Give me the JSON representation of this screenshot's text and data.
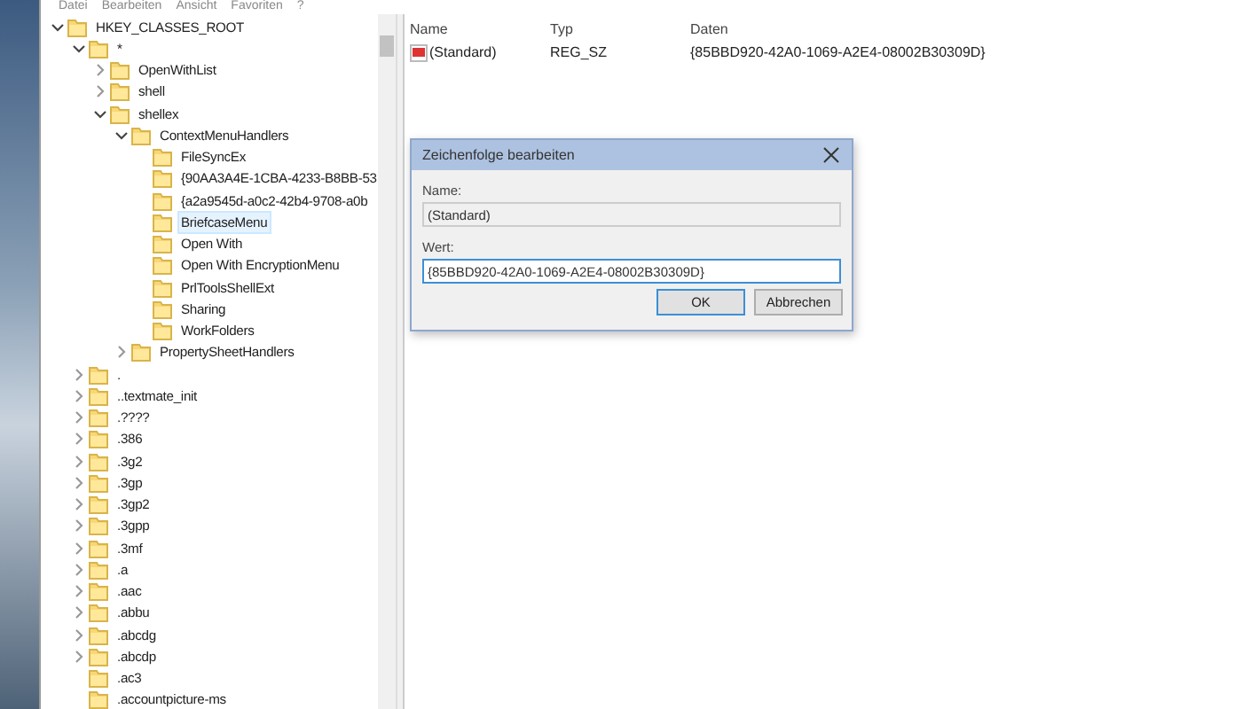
{
  "menu": [
    "Datei",
    "Bearbeiten",
    "Ansicht",
    "Favoriten",
    "?"
  ],
  "tree": [
    {
      "label": "HKEY_CLASSES_ROOT",
      "expanded": true,
      "selected": false,
      "children": [
        {
          "label": "*",
          "expanded": true,
          "selected": false,
          "children": [
            {
              "label": "OpenWithList",
              "expanded": false,
              "selected": false
            },
            {
              "label": "shell",
              "expanded": false,
              "selected": false
            },
            {
              "label": "shellex",
              "expanded": true,
              "selected": false,
              "children": [
                {
                  "label": "ContextMenuHandlers",
                  "expanded": true,
                  "selected": false,
                  "children": [
                    {
                      "label": "FileSyncEx",
                      "selected": false
                    },
                    {
                      "label": "{90AA3A4E-1CBA-4233-B8BB-53",
                      "selected": false
                    },
                    {
                      "label": "{a2a9545d-a0c2-42b4-9708-a0b",
                      "selected": false
                    },
                    {
                      "label": "BriefcaseMenu",
                      "selected": true
                    },
                    {
                      "label": "Open With",
                      "selected": false
                    },
                    {
                      "label": "Open With EncryptionMenu",
                      "selected": false
                    },
                    {
                      "label": "PrlToolsShellExt",
                      "selected": false
                    },
                    {
                      "label": "Sharing",
                      "selected": false
                    },
                    {
                      "label": "WorkFolders",
                      "selected": false
                    }
                  ]
                },
                {
                  "label": "PropertySheetHandlers",
                  "expanded": false,
                  "selected": false
                }
              ]
            }
          ]
        },
        {
          "label": ".",
          "expanded": false,
          "selected": false
        },
        {
          "label": "..textmate_init",
          "expanded": false,
          "selected": false
        },
        {
          "label": ".????",
          "expanded": false,
          "selected": false
        },
        {
          "label": ".386",
          "expanded": false,
          "selected": false
        },
        {
          "label": ".3g2",
          "expanded": false,
          "selected": false
        },
        {
          "label": ".3gp",
          "expanded": false,
          "selected": false
        },
        {
          "label": ".3gp2",
          "expanded": false,
          "selected": false
        },
        {
          "label": ".3gpp",
          "expanded": false,
          "selected": false
        },
        {
          "label": ".3mf",
          "expanded": false,
          "selected": false
        },
        {
          "label": ".a",
          "expanded": false,
          "selected": false
        },
        {
          "label": ".aac",
          "expanded": false,
          "selected": false
        },
        {
          "label": ".abbu",
          "expanded": false,
          "selected": false
        },
        {
          "label": ".abcdg",
          "expanded": false,
          "selected": false
        },
        {
          "label": ".abcdp",
          "expanded": false,
          "selected": false
        },
        {
          "label": ".ac3",
          "selected": false
        },
        {
          "label": ".accountpicture-ms",
          "selected": false
        }
      ]
    }
  ],
  "values": {
    "columns": [
      "Name",
      "Typ",
      "Daten"
    ],
    "rows": [
      {
        "name": "(Standard)",
        "type": "REG_SZ",
        "data": "{85BBD920-42A0-1069-A2E4-08002B30309D}"
      }
    ]
  },
  "dialog": {
    "title": "Zeichenfolge bearbeiten",
    "name_label": "Name:",
    "name_value": "(Standard)",
    "value_label": "Wert:",
    "value": "{85BBD920-42A0-1069-A2E4-08002B30309D}",
    "buttons": [
      "OK",
      "Abbrechen"
    ]
  }
}
